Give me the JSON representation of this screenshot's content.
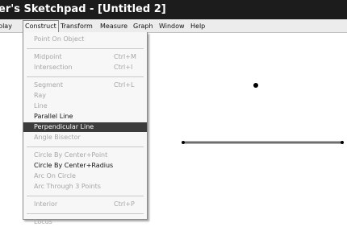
{
  "window": {
    "title": "er's Sketchpad - [Untitled 2]"
  },
  "menubar": {
    "items": [
      "play",
      "Construct",
      "Transform",
      "Measure",
      "Graph",
      "Window",
      "Help"
    ]
  },
  "construct_menu": {
    "groups": [
      [
        {
          "label": "Point On Object",
          "shortcut": "",
          "enabled": false
        }
      ],
      [
        {
          "label": "Midpoint",
          "shortcut": "Ctrl+M",
          "enabled": false
        },
        {
          "label": "Intersection",
          "shortcut": "Ctrl+I",
          "enabled": false
        }
      ],
      [
        {
          "label": "Segment",
          "shortcut": "Ctrl+L",
          "enabled": false
        },
        {
          "label": "Ray",
          "shortcut": "",
          "enabled": false
        },
        {
          "label": "Line",
          "shortcut": "",
          "enabled": false
        },
        {
          "label": "Parallel Line",
          "shortcut": "",
          "enabled": true
        },
        {
          "label": "Perpendicular Line",
          "shortcut": "",
          "enabled": true,
          "highlighted": true
        },
        {
          "label": "Angle Bisector",
          "shortcut": "",
          "enabled": false
        }
      ],
      [
        {
          "label": "Circle By Center+Point",
          "shortcut": "",
          "enabled": false
        },
        {
          "label": "Circle By Center+Radius",
          "shortcut": "",
          "enabled": true
        },
        {
          "label": "Arc On Circle",
          "shortcut": "",
          "enabled": false
        },
        {
          "label": "Arc Through 3 Points",
          "shortcut": "",
          "enabled": false
        }
      ],
      [
        {
          "label": "Interior",
          "shortcut": "Ctrl+P",
          "enabled": false
        }
      ],
      [
        {
          "label": "Locus",
          "shortcut": "",
          "enabled": false
        }
      ]
    ]
  },
  "colors": {
    "titlebar": "#1c1c1c",
    "menubar": "#ececec",
    "highlight": "#3c3c3c",
    "disabled_text": "#a6a6a6"
  }
}
